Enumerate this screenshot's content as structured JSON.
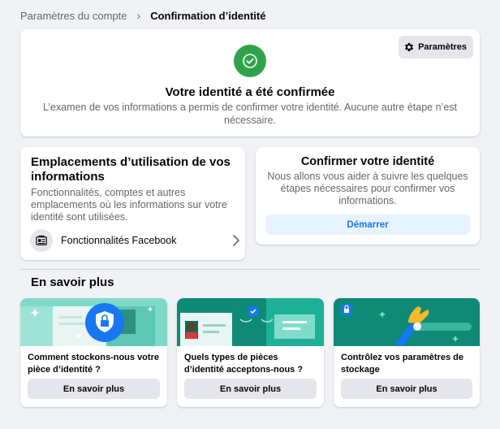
{
  "breadcrumb": {
    "parent": "Paramètres du compte",
    "separator": "›",
    "current": "Confirmation d’identité"
  },
  "confirmation": {
    "settings_label": "Paramètres",
    "settings_icon": "gear-icon",
    "status_icon": "checkmark-icon",
    "status_color": "#31a24c",
    "title": "Votre identité a été confirmée",
    "description": "L’examen de vos informations a permis de confirmer votre identité. Aucune autre étape n’est nécessaire."
  },
  "usage": {
    "title": "Emplacements d’utilisation de vos informations",
    "description": "Fonctionnalités, comptes et autres emplacements où les informations sur votre identité sont utilisées.",
    "item_label": "Fonctionnalités Facebook",
    "item_icon": "features-icon"
  },
  "verify": {
    "title": "Confirmer votre identité",
    "description": "Nous allons vous aider à suivre les quelques étapes nécessaires pour confirmer vos informations.",
    "button_label": "Démarrer",
    "accent": "#1877f2"
  },
  "learn_more": {
    "heading": "En savoir plus",
    "cards": [
      {
        "title": "Comment stockons-nous votre pièce d’identité ?",
        "button_label": "En savoir plus"
      },
      {
        "title": "Quels types de pièces d’identité acceptons-nous ?",
        "button_label": "En savoir plus"
      },
      {
        "title": "Contrôlez vos paramètres de stockage",
        "button_label": "En savoir plus"
      }
    ]
  }
}
